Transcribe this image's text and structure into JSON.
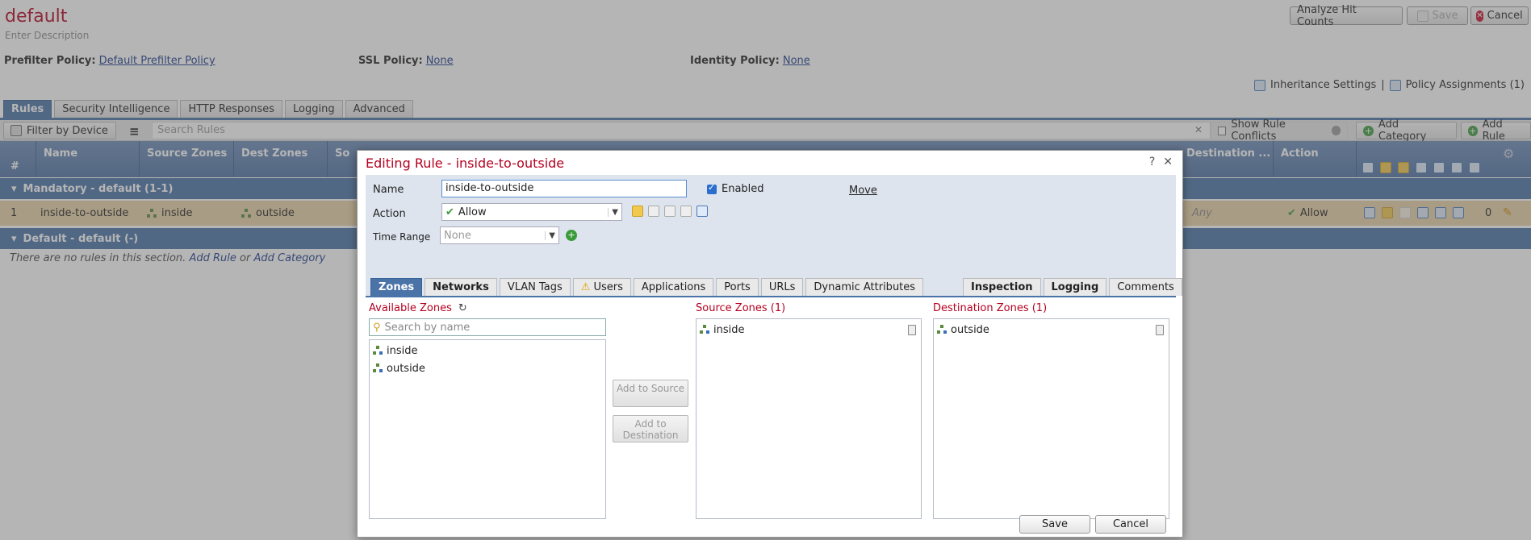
{
  "policy": {
    "title": "default",
    "description": "Enter Description",
    "prefilter_label": "Prefilter Policy:",
    "prefilter_value": "Default Prefilter Policy",
    "ssl_label": "SSL Policy:",
    "ssl_value": "None",
    "identity_label": "Identity Policy:",
    "identity_value": "None"
  },
  "header_buttons": {
    "analyze": "Analyze Hit Counts",
    "save": "Save",
    "cancel": "Cancel"
  },
  "links": {
    "inheritance": "Inheritance Settings",
    "separator": "|",
    "assignments": "Policy Assignments (1)"
  },
  "main_tabs": [
    "Rules",
    "Security Intelligence",
    "HTTP Responses",
    "Logging",
    "Advanced"
  ],
  "toolbar": {
    "filter_device": "Filter by Device",
    "search_placeholder": "Search Rules",
    "clear": "✕",
    "show_conflicts": "Show Rule Conflicts",
    "add_category": "Add Category",
    "add_rule": "Add Rule"
  },
  "table": {
    "headers": {
      "num": "#",
      "name": "Name",
      "source_zones": "Source Zones",
      "dest_zones": "Dest Zones",
      "so": "So",
      "destination": "Destination ...",
      "action": "Action"
    },
    "sections": {
      "mandatory": "Mandatory - default (1-1)",
      "default": "Default - default (-)"
    },
    "row": {
      "num": "1",
      "name": "inside-to-outside",
      "source": "inside",
      "dest": "outside",
      "any": "Any",
      "action": "Allow",
      "count": "0"
    },
    "empty": {
      "text": "There are no rules in this section.",
      "add_rule": "Add Rule",
      "or": "or",
      "add_category": "Add Category"
    }
  },
  "modal": {
    "title": "Editing Rule - inside-to-outside",
    "help": "?",
    "close": "✕",
    "name_label": "Name",
    "name_value": "inside-to-outside",
    "enabled_label": "Enabled",
    "move_label": "Move",
    "action_label": "Action",
    "action_value": "Allow",
    "time_range_label": "Time Range",
    "time_range_placeholder": "None",
    "tabs": [
      "Zones",
      "Networks",
      "VLAN Tags",
      "Users",
      "Applications",
      "Ports",
      "URLs",
      "Dynamic Attributes"
    ],
    "right_tabs": [
      "Inspection",
      "Logging",
      "Comments"
    ],
    "available_title": "Available Zones",
    "search_placeholder": "Search by name",
    "available_zones": [
      "inside",
      "outside"
    ],
    "add_to_source": "Add to Source",
    "add_to_destination": "Add to Destination",
    "source_title": "Source Zones (1)",
    "source_zones": [
      "inside"
    ],
    "dest_title": "Destination Zones (1)",
    "dest_zones": [
      "outside"
    ],
    "save": "Save",
    "cancel": "Cancel"
  },
  "colors": {
    "accent": "#4a73a8",
    "title_red": "#b5001f",
    "row_highlight": "#e9d2a7",
    "modal_body": "#dde4ee"
  }
}
